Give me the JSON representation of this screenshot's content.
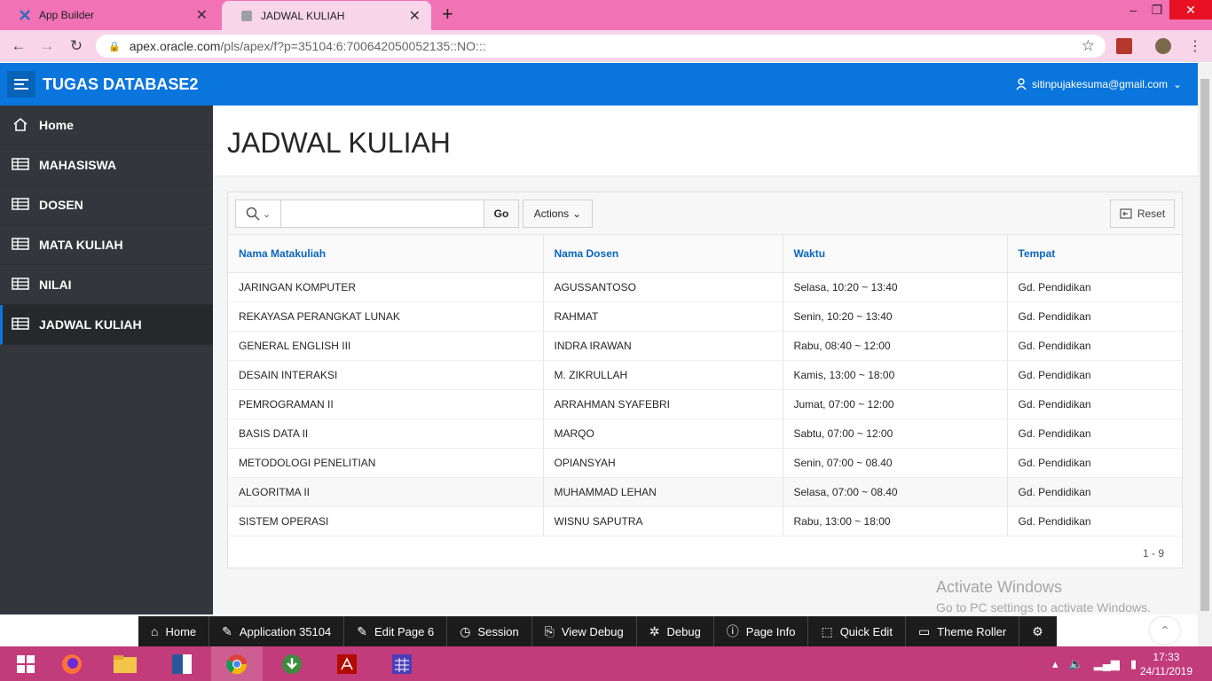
{
  "browser": {
    "tabs": [
      {
        "title": "App Builder",
        "icon": "apex-icon"
      },
      {
        "title": "JADWAL KULIAH",
        "icon": "page-icon"
      }
    ],
    "url_host": "apex.oracle.com",
    "url_path": "/pls/apex/f?p=35104:6:700642050052135::NO:::"
  },
  "app": {
    "name": "TUGAS DATABASE2",
    "user": "sitinpujakesuma@gmail.com"
  },
  "sidebar": {
    "items": [
      {
        "label": "Home",
        "icon": "home-icon"
      },
      {
        "label": "MAHASISWA",
        "icon": "table-icon"
      },
      {
        "label": "DOSEN",
        "icon": "table-icon"
      },
      {
        "label": "MATA KULIAH",
        "icon": "table-icon"
      },
      {
        "label": "NILAI",
        "icon": "table-icon"
      },
      {
        "label": "JADWAL KULIAH",
        "icon": "table-icon",
        "active": true
      }
    ]
  },
  "page": {
    "title": "JADWAL KULIAH"
  },
  "report": {
    "search_value": "",
    "go_label": "Go",
    "actions_label": "Actions",
    "reset_label": "Reset",
    "columns": [
      "Nama Matakuliah",
      "Nama Dosen",
      "Waktu",
      "Tempat"
    ],
    "rows": [
      [
        "JARINGAN KOMPUTER",
        "AGUSSANTOSO",
        "Selasa, 10:20 ~ 13:40",
        "Gd. Pendidikan"
      ],
      [
        "REKAYASA PERANGKAT LUNAK",
        "RAHMAT",
        "Senin, 10:20 ~ 13:40",
        "Gd. Pendidikan"
      ],
      [
        "GENERAL ENGLISH III",
        "INDRA IRAWAN",
        "Rabu, 08:40 ~ 12:00",
        "Gd. Pendidikan"
      ],
      [
        "DESAIN INTERAKSI",
        "M. ZIKRULLAH",
        "Kamis, 13:00 ~ 18:00",
        "Gd. Pendidikan"
      ],
      [
        "PEMROGRAMAN II",
        "ARRAHMAN SYAFEBRI",
        "Jumat, 07:00 ~ 12:00",
        "Gd. Pendidikan"
      ],
      [
        "BASIS DATA II",
        "MARQO",
        "Sabtu, 07:00 ~ 12:00",
        "Gd. Pendidikan"
      ],
      [
        "METODOLOGI PENELITIAN",
        "OPIANSYAH",
        "Senin, 07:00 ~ 08.40",
        "Gd. Pendidikan"
      ],
      [
        "ALGORITMA II",
        "MUHAMMAD LEHAN",
        "Selasa, 07:00 ~ 08.40",
        "Gd. Pendidikan"
      ],
      [
        "SISTEM OPERASI",
        "WISNU SAPUTRA",
        "Rabu, 13:00 ~ 18:00",
        "Gd. Pendidikan"
      ]
    ],
    "pagination": "1 - 9"
  },
  "watermark": {
    "line1": "Activate Windows",
    "line2": "Go to PC settings to activate Windows."
  },
  "devbar": {
    "items": [
      {
        "label": "Home",
        "icon": "home-icon"
      },
      {
        "label": "Application 35104",
        "icon": "edit-icon"
      },
      {
        "label": "Edit Page 6",
        "icon": "edit-icon"
      },
      {
        "label": "Session",
        "icon": "clock-icon"
      },
      {
        "label": "View Debug",
        "icon": "debug-view-icon"
      },
      {
        "label": "Debug",
        "icon": "bug-icon"
      },
      {
        "label": "Page Info",
        "icon": "info-icon"
      },
      {
        "label": "Quick Edit",
        "icon": "cursor-icon"
      },
      {
        "label": "Theme Roller",
        "icon": "paint-roller-icon"
      }
    ]
  },
  "taskbar": {
    "time": "17:33",
    "date": "24/11/2019"
  },
  "colors": {
    "header_blue": "#0a75dd",
    "sidebar": "#33373b",
    "tab_strip": "#f272b6",
    "taskbar": "#c23b7a",
    "link_blue": "#0a66c2"
  }
}
